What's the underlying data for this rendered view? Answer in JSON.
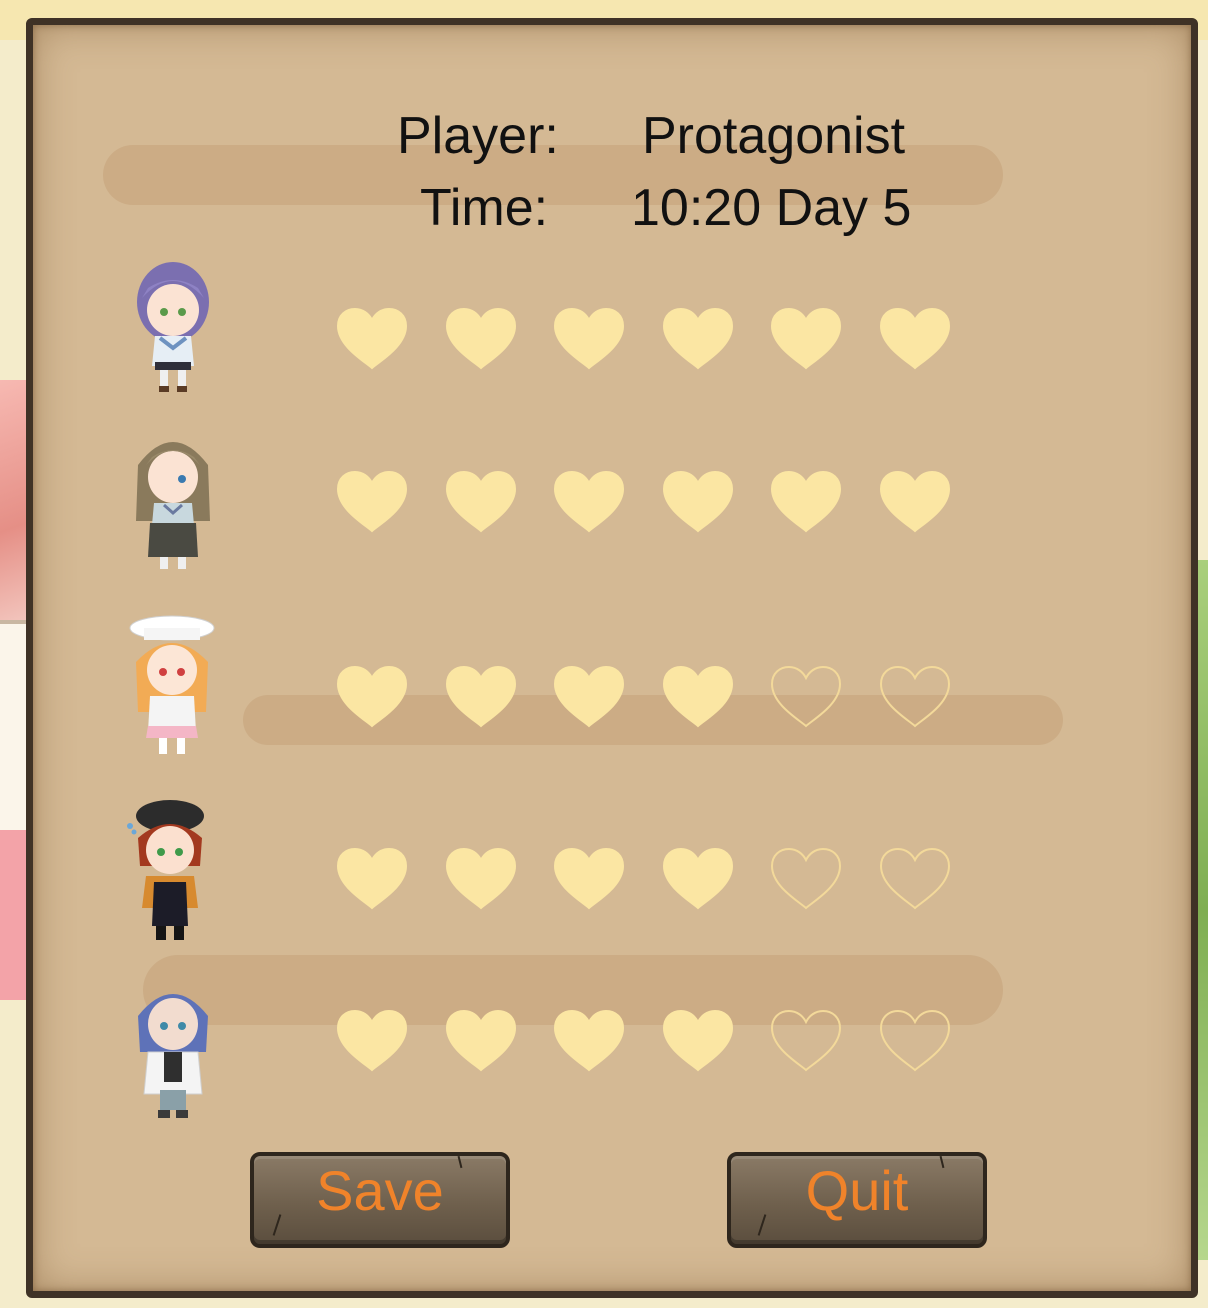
{
  "header": {
    "player_label": "Player:",
    "player_value": "Protagonist",
    "time_label": "Time:",
    "time_value": "10:20 Day 5"
  },
  "affection": {
    "max_hearts": 6,
    "characters": [
      {
        "filled_hearts": 6
      },
      {
        "filled_hearts": 6
      },
      {
        "filled_hearts": 4
      },
      {
        "filled_hearts": 4
      },
      {
        "filled_hearts": 4
      }
    ]
  },
  "buttons": {
    "save_label": "Save",
    "quit_label": "Quit"
  },
  "colors": {
    "heart_filled": "#fbe6a3",
    "heart_outline": "#f3d99a",
    "button_text": "#f0832a",
    "board_border": "#3f3226",
    "parchment": "#d4b994"
  }
}
